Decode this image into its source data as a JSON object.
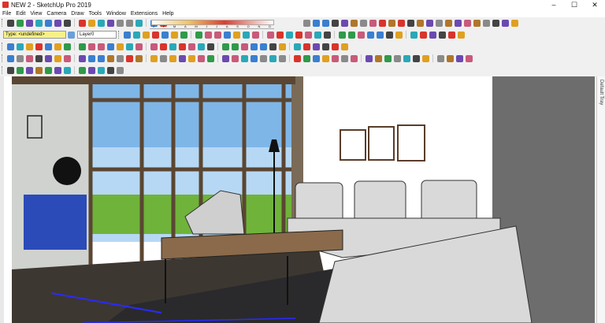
{
  "window": {
    "title": "NEW 2 - SketchUp Pro 2019",
    "minimize": "–",
    "maximize": "☐",
    "close": "✕"
  },
  "menu": [
    "File",
    "Edit",
    "View",
    "Camera",
    "Draw",
    "Tools",
    "Window",
    "Extensions",
    "Help"
  ],
  "entity_info": {
    "type_label": "Type: <undefined>",
    "layer_label": "Layer0"
  },
  "shadow": {
    "months": [
      "J",
      "F",
      "M",
      "A",
      "M",
      "J",
      "J",
      "A",
      "S",
      "O",
      "N",
      "D"
    ],
    "time_start": "06:43 AM",
    "time_noon": "Noon",
    "time_end": "04:45 PM"
  },
  "side_panel": {
    "label": "Default Tray"
  },
  "icons": {
    "row1": [
      "new-icon",
      "open-icon",
      "save-icon",
      "cut-icon",
      "copy-icon",
      "paste-icon",
      "erase-icon",
      "undo-icon",
      "redo-icon",
      "print-icon",
      "model-info-icon",
      "camera-icon",
      "shadow-toggle-icon",
      "fog-icon",
      "xray-icon",
      "back-edges-icon",
      "wireframe-icon",
      "hidden-line-icon",
      "shaded-icon",
      "textured-icon",
      "monochrome-icon",
      "push-pull-icon",
      "follow-me-icon",
      "rotate-icon",
      "scale-icon",
      "intersect-icon",
      "union-icon",
      "subtract-icon",
      "trim-icon",
      "split-icon",
      "warehouse-icon",
      "extension-warehouse-icon",
      "components-icon",
      "upload-icon",
      "play-icon",
      "stop-icon",
      "section-plane-icon",
      "display-section-icon",
      "settings-icon"
    ],
    "row2": [
      "select-icon",
      "component-icon",
      "paint-bucket-icon",
      "eraser-icon",
      "line-icon",
      "arc-icon",
      "rectangle-icon",
      "circle-icon",
      "polygon-icon",
      "move-icon",
      "rotate-icon",
      "scale-icon",
      "offset-icon",
      "tape-measure-icon",
      "dimension-icon",
      "protractor-icon",
      "text-icon",
      "axes-icon",
      "3d-text-icon",
      "orbit-icon",
      "pan-icon",
      "zoom-icon",
      "zoom-window-icon",
      "zoom-extents-icon",
      "walk-icon",
      "look-around-icon",
      "position-camera-icon",
      "sandbox-icon",
      "iso-view-icon",
      "top-view-icon",
      "front-view-icon",
      "right-view-icon",
      "back-view-icon",
      "left-view-icon"
    ],
    "row3": [
      "select-icon",
      "eraser-icon",
      "paint-icon",
      "line-icon",
      "freehand-icon",
      "arc-icon",
      "pie-icon",
      "rectangle-icon",
      "rotated-rect-icon",
      "push-pull-icon",
      "move-icon",
      "rotate-icon",
      "follow-me-icon",
      "scale-icon",
      "offset-icon",
      "tape-icon",
      "protractor-icon",
      "dimension-icon",
      "text-icon",
      "axes-icon",
      "3d-text-icon",
      "section-icon",
      "orbit-icon",
      "pan-icon",
      "zoom-icon",
      "walk-icon",
      "look-icon",
      "position-icon",
      "sandbox-from-contours-icon",
      "sandbox-from-scratch-icon",
      "smoove-icon",
      "stamp-icon",
      "drape-icon",
      "add-detail-icon",
      "flip-edge-icon",
      "solid-inspector-icon",
      "teapot-icon",
      "sphere-icon",
      "cloud-icon",
      "panel-icon",
      "geo-icon",
      "model-icon",
      "tag-icon",
      "style-icon",
      "material-icon",
      "export-icon"
    ],
    "row4": [
      "car-icon",
      "sofa-icon",
      "lamp-icon",
      "chair-icon",
      "table-icon",
      "plant-icon",
      "door-icon",
      "window-icon",
      "stairs-icon",
      "light-icon",
      "sun-icon",
      "render-icon"
    ]
  }
}
